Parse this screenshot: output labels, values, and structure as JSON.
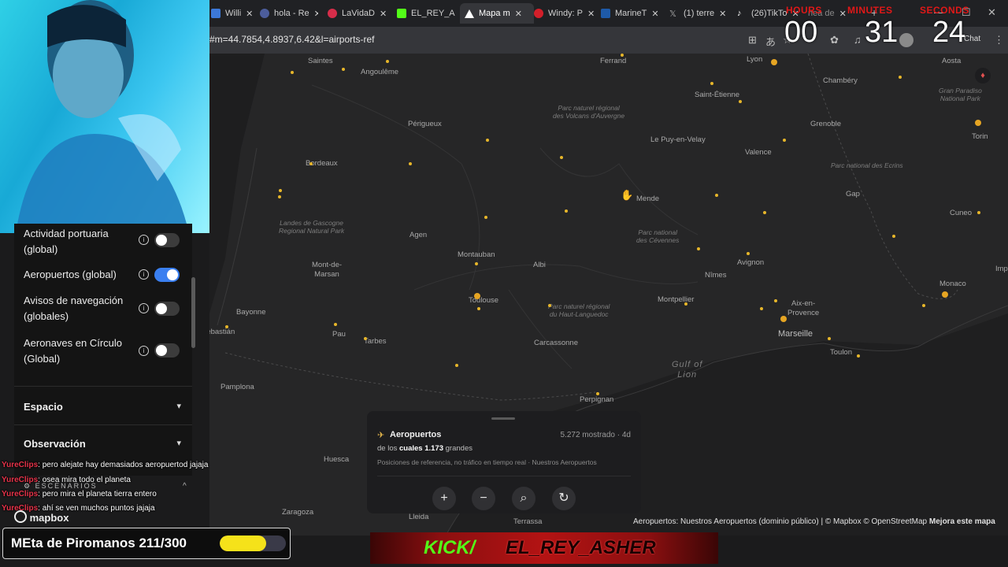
{
  "tabs": [
    {
      "label": "Willi",
      "icon": "document-icon",
      "color": "#3c78d8"
    },
    {
      "label": "hola - Re",
      "icon": "r-icon",
      "color": "#4c5d9c"
    },
    {
      "label": "LaVidaD",
      "icon": "youtube-icon",
      "color": "#d62d4a"
    },
    {
      "label": "EL_REY_A",
      "icon": "kick-icon",
      "color": "#53fc18"
    },
    {
      "label": "Mapa m",
      "icon": "map-icon",
      "color": "#ffffff"
    },
    {
      "label": "Windy: P",
      "icon": "windy-icon",
      "color": "#d31f2a"
    },
    {
      "label": "MarineT",
      "icon": "marine-icon",
      "color": "#1e5aa8"
    },
    {
      "label": "(1) terre",
      "icon": "x-icon",
      "color": "#aaaaaa"
    },
    {
      "label": "(26)TikTo",
      "icon": "tiktok-icon",
      "color": "#ffffff"
    },
    {
      "label": "nea de",
      "icon": "document-icon",
      "color": "#888888"
    }
  ],
  "address": {
    "url": "#m=44.7854,4.8937,6.42&l=airports-ref"
  },
  "timer": {
    "hours_label": "HOURS",
    "minutes_label": "MINUTES",
    "seconds_label": "SECONDS",
    "hours": "00",
    "minutes": "31",
    "seconds": "24"
  },
  "toolbar": {
    "chat_label": "Chat"
  },
  "map": {
    "cities": [
      {
        "name": "Saintes"
      },
      {
        "name": "Angoulême"
      },
      {
        "name": "Périgueux"
      },
      {
        "name": "Bordeaux"
      },
      {
        "name": "Agen"
      },
      {
        "name": "Mont-de-\nMarsan"
      },
      {
        "name": "Bayonne"
      },
      {
        "name": "Sebastián"
      },
      {
        "name": "Pau"
      },
      {
        "name": "Tarbes"
      },
      {
        "name": "Pamplona"
      },
      {
        "name": "Montauban"
      },
      {
        "name": "Albi"
      },
      {
        "name": "Toulouse"
      },
      {
        "name": "Carcassonne"
      },
      {
        "name": "Perpignan"
      },
      {
        "name": "Huesca"
      },
      {
        "name": "Zaragoza"
      },
      {
        "name": "Lleida"
      },
      {
        "name": "Terrassa"
      },
      {
        "name": "Ferrand"
      },
      {
        "name": "Lyon"
      },
      {
        "name": "Chambéry"
      },
      {
        "name": "Saint-Étienne"
      },
      {
        "name": "Grenoble"
      },
      {
        "name": "Le Puy-en-Velay"
      },
      {
        "name": "Valence"
      },
      {
        "name": "Mende"
      },
      {
        "name": "Gap"
      },
      {
        "name": "Nîmes"
      },
      {
        "name": "Avignon"
      },
      {
        "name": "Montpellier"
      },
      {
        "name": "Aix-en-\nProvence"
      },
      {
        "name": "Marseille"
      },
      {
        "name": "Toulon"
      },
      {
        "name": "Monaco"
      },
      {
        "name": "Cuneo"
      },
      {
        "name": "Torin"
      },
      {
        "name": "Aosta"
      },
      {
        "name": "Imp"
      }
    ],
    "parks": [
      {
        "name": "Parc naturel régional\ndes Volcans d'Auvergne"
      },
      {
        "name": "Landes de Gascogne\nRegional Natural Park"
      },
      {
        "name": "Parc national\ndes Cévennes"
      },
      {
        "name": "Parc naturel régional\ndu Haut-Languedoc"
      },
      {
        "name": "Parc national des Ecrins"
      },
      {
        "name": "Gran Paradiso\nNational Park"
      },
      {
        "name": "Gulf of\nLion"
      }
    ],
    "attribution": {
      "airports": "Aeropuertos: Nuestros Aeropuertos (dominio público)",
      "sep": "|",
      "mapbox": "© Mapbox",
      "osm": "© OpenStreetMap",
      "improve": "Mejora este mapa"
    },
    "logo": "mapbox"
  },
  "sidebar": {
    "layers": [
      {
        "label": "Actividad portuaria\n(global)",
        "on": false
      },
      {
        "label": "Aeropuertos (global)",
        "on": true
      },
      {
        "label": "Avisos de navegación\n(globales)",
        "on": false
      },
      {
        "label": "Aeronaves en Círculo\n(Global)",
        "on": false
      }
    ],
    "sections": [
      {
        "label": "Espacio"
      },
      {
        "label": "Observación"
      }
    ],
    "scenarios_label": "ESCENARIOS"
  },
  "card": {
    "title": "Aeropuertos",
    "count": "5.272 mostrado · 4d",
    "subtitle_prefix": "de los",
    "subtitle_count": "cuales 1.173",
    "subtitle_suffix": "grandes",
    "note": "Posiciones de referencia, no tráfico en tiempo real · Nuestros Aeropuertos",
    "buttons": [
      {
        "glyph": "+",
        "icon": "zoom-in-icon"
      },
      {
        "glyph": "−",
        "icon": "zoom-out-icon"
      },
      {
        "glyph": "⌕",
        "icon": "search-icon"
      },
      {
        "glyph": "↻",
        "icon": "refresh-icon"
      }
    ]
  },
  "chat": [
    {
      "user": "YureClips",
      "message": ": pero alejate hay demasiados aeropuertod jajaja"
    },
    {
      "user": "YureClips",
      "message": ": osea mira todo el planeta"
    },
    {
      "user": "YureClips",
      "message": ": pero mira el planeta tierra entero"
    },
    {
      "user": "YureClips",
      "message": ": ahí se ven muchos puntos jajaja"
    }
  ],
  "goal": {
    "label": "MEta de Piromanos 211/300",
    "current": 211,
    "target": 300,
    "color": "#f5e21a"
  },
  "kick": {
    "prefix": "KICK/",
    "name": "EL_REY_ASHER"
  }
}
